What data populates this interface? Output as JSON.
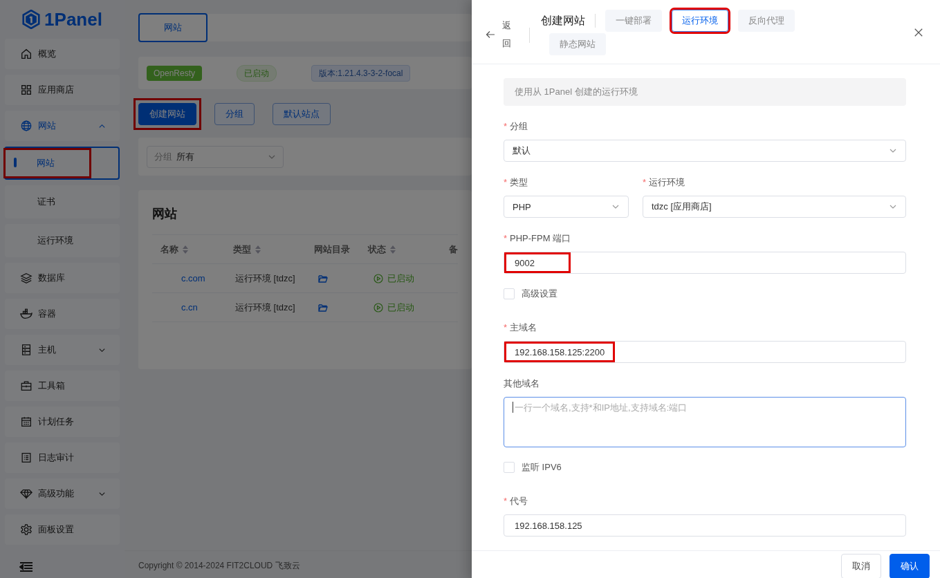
{
  "logo": {
    "text": "1Panel"
  },
  "sidebar": {
    "items": [
      {
        "label": "概览",
        "selected": false
      },
      {
        "label": "应用商店",
        "selected": false
      },
      {
        "label": "网站",
        "selected": true,
        "expanded": true,
        "children": [
          {
            "label": "网站",
            "selected": true,
            "annotated": true
          },
          {
            "label": "证书",
            "selected": false,
            "annotated": false
          },
          {
            "label": "运行环境",
            "selected": false,
            "annotated": false
          }
        ]
      },
      {
        "label": "数据库",
        "selected": false
      },
      {
        "label": "容器",
        "selected": false
      },
      {
        "label": "主机",
        "selected": false,
        "expanded": false
      },
      {
        "label": "工具箱",
        "selected": false
      },
      {
        "label": "计划任务",
        "selected": false
      },
      {
        "label": "日志审计",
        "selected": false
      },
      {
        "label": "高级功能",
        "selected": false,
        "expanded": false
      },
      {
        "label": "面板设置",
        "selected": false
      }
    ]
  },
  "page_tab": {
    "label": "网站",
    "selected": true
  },
  "app_status": [
    {
      "kind": "app",
      "text": "OpenResty"
    },
    {
      "kind": "status",
      "text": "已启动"
    },
    {
      "kind": "version",
      "text": "版本:1.21.4.3-3-2-focal"
    }
  ],
  "toolbar": [
    {
      "label": "创建网站",
      "primary": true,
      "annotated": true
    },
    {
      "label": "分组",
      "primary": false,
      "annotated": false
    },
    {
      "label": "默认站点",
      "primary": false,
      "annotated": false
    }
  ],
  "filter": {
    "label": "分组",
    "value": "所有"
  },
  "table": {
    "title": "网站",
    "columns": [
      {
        "label": "名称",
        "sortable": true
      },
      {
        "label": "类型",
        "sortable": true
      },
      {
        "label": "网站目录",
        "sortable": false
      },
      {
        "label": "状态",
        "sortable": true
      },
      {
        "label": "备",
        "sortable": false
      }
    ],
    "rows": [
      {
        "name": "c.com",
        "type": "运行环境 [tdzc]",
        "status": "已启动"
      },
      {
        "name": "c.cn",
        "type": "运行环境 [tdzc]",
        "status": "已启动"
      }
    ]
  },
  "copyright": "Copyright © 2014-2024 FIT2CLOUD 飞致云",
  "drawer": {
    "back": "返回",
    "title": "创建网站",
    "tabs": [
      {
        "label": "一键部署",
        "selected": false,
        "annotated": false
      },
      {
        "label": "运行环境",
        "selected": true,
        "annotated": true
      },
      {
        "label": "反向代理",
        "selected": false,
        "annotated": false
      },
      {
        "label": "静态网站",
        "selected": false,
        "annotated": false
      }
    ],
    "notice": "使用从 1Panel 创建的运行环境",
    "fields": [
      {
        "kind": "select",
        "label": "分组",
        "required_mark": "*",
        "value": "默认"
      },
      {
        "kind": "row",
        "fields": [
          {
            "kind": "select",
            "label": "类型",
            "required_mark": "*",
            "value": "PHP"
          },
          {
            "kind": "select",
            "label": "运行环境",
            "required_mark": "*",
            "value": "tdzc [应用商店]"
          }
        ]
      },
      {
        "kind": "input",
        "label": "PHP-FPM 端口",
        "required_mark": "*",
        "value": "9002",
        "annotated": true
      },
      {
        "kind": "checkbox",
        "label": "高级设置",
        "checked": false
      },
      {
        "kind": "input",
        "label": "主域名",
        "required_mark": "*",
        "value": "192.168.158.125:2200",
        "annotated": true
      },
      {
        "kind": "textarea",
        "label": "其他域名",
        "placeholder": "一行一个域名,支持*和IP地址,支持域名:端口",
        "focused": true
      },
      {
        "kind": "checkbox",
        "label": "监听 IPV6",
        "checked": false
      },
      {
        "kind": "input",
        "label": "代号",
        "required_mark": "*",
        "value": "192.168.158.125",
        "annotated": false
      }
    ],
    "buttons": [
      {
        "label": "取消",
        "primary": false
      },
      {
        "label": "确认",
        "primary": true
      }
    ]
  }
}
